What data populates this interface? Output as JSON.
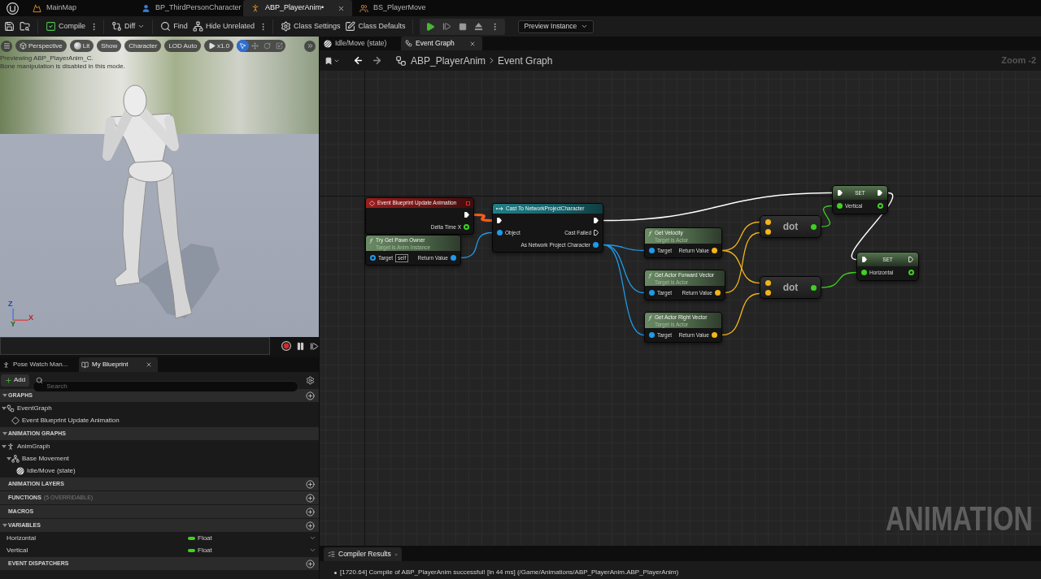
{
  "editor_tabs": [
    {
      "label": "MainMap",
      "kind": "level",
      "selected": false
    },
    {
      "label": "BP_ThirdPersonCharacter",
      "kind": "blueprint",
      "selected": false
    },
    {
      "label": "ABP_PlayerAnim•",
      "kind": "anim_blueprint",
      "selected": true
    },
    {
      "label": "BS_PlayerMove",
      "kind": "blend_space",
      "selected": false
    }
  ],
  "toolbar": {
    "items": [
      {
        "kind": "save",
        "more": false,
        "dropdown": false
      },
      {
        "kind": "browse",
        "more": false,
        "dropdown": false
      },
      {
        "kind": "compile",
        "label": "Compile",
        "more": true,
        "dropdown": false
      },
      {
        "kind": "diff",
        "label": "Diff",
        "more": false,
        "dropdown": true
      },
      {
        "kind": "find",
        "label": "Find",
        "more": false,
        "dropdown": false
      },
      {
        "kind": "hide_unrelated",
        "label": "Hide Unrelated",
        "more": true,
        "dropdown": false
      },
      {
        "kind": "class_settings",
        "label": "Class Settings",
        "more": false,
        "dropdown": false
      },
      {
        "kind": "class_defaults",
        "label": "Class Defaults",
        "more": false,
        "dropdown": false
      }
    ],
    "play_controls": [
      {
        "kind": "play"
      },
      {
        "kind": "advance"
      },
      {
        "kind": "stop"
      },
      {
        "kind": "eject"
      }
    ],
    "debug_dropdown": {
      "label": "Preview Instance"
    }
  },
  "viewport": {
    "toolbar": [
      {
        "kind": "menu"
      },
      {
        "kind": "perspective",
        "label": "Perspective"
      },
      {
        "kind": "lit",
        "label": "Lit"
      },
      {
        "kind": "option",
        "label": "Show"
      },
      {
        "kind": "option",
        "label": "Character"
      },
      {
        "kind": "option",
        "label": "LOD Auto"
      },
      {
        "kind": "speed",
        "label": "x1.0"
      }
    ],
    "transform_tools": [
      {
        "kind": "select",
        "selected": true
      },
      {
        "kind": "move",
        "selected": false
      },
      {
        "kind": "rotate",
        "selected": false
      },
      {
        "kind": "scale",
        "selected": false
      }
    ],
    "messages": [
      "Previewing ABP_PlayerAnim_C.",
      "Bone manipulation is disabled in this mode."
    ],
    "axis_labels": [
      "Z",
      "X",
      "Y"
    ],
    "playback": [
      {
        "kind": "record"
      },
      {
        "kind": "pause"
      },
      {
        "kind": "step"
      }
    ]
  },
  "my_blueprint": {
    "tabs": [
      {
        "label": "Pose Watch Man...",
        "kind": "pose_watch",
        "selected": false
      },
      {
        "label": "My Blueprint",
        "kind": "blueprint",
        "selected": true
      }
    ],
    "add_button": "Add",
    "search": {
      "placeholder": "Search"
    },
    "sections": [
      {
        "title": "GRAPHS",
        "expanded": true,
        "addable": true,
        "items": [
          {
            "label": "EventGraph",
            "kind": "graph",
            "expanded": true,
            "children": [
              {
                "label": "Event Blueprint Update Animation",
                "kind": "event",
                "expanded": false
              }
            ]
          }
        ]
      },
      {
        "title": "ANIMATION GRAPHS",
        "expanded": true,
        "addable": false,
        "items": [
          {
            "label": "AnimGraph",
            "kind": "anim_graph",
            "expanded": true,
            "children": [
              {
                "label": "Base Movement",
                "kind": "state_machine",
                "expanded": true,
                "children": [
                  {
                    "label": "Idle/Move (state)",
                    "kind": "state",
                    "expanded": false
                  }
                ]
              }
            ]
          }
        ]
      },
      {
        "title": "ANIMATION LAYERS",
        "expanded": false,
        "addable": true
      },
      {
        "title": "FUNCTIONS",
        "note": "(5 OVERRIDABLE)",
        "expanded": false,
        "addable": true
      },
      {
        "title": "MACROS",
        "expanded": false,
        "addable": true
      },
      {
        "title": "VARIABLES",
        "expanded": true,
        "addable": true,
        "variables": [
          {
            "name": "Horizontal",
            "type": "Float",
            "color": "#3fd11f"
          },
          {
            "name": "Vertical",
            "type": "Float",
            "color": "#3fd11f"
          }
        ]
      },
      {
        "title": "EVENT DISPATCHERS",
        "expanded": false,
        "addable": true
      }
    ]
  },
  "graph": {
    "tabs": [
      {
        "label": "Idle/Move (state)",
        "kind": "state",
        "selected": false
      },
      {
        "label": "Event Graph",
        "kind": "graph",
        "selected": true
      }
    ],
    "breadcrumb": [
      "ABP_PlayerAnim",
      "Event Graph"
    ],
    "zoom": "Zoom -2",
    "graph_type_label": "ANIMATION",
    "nodes": [
      {
        "kind": "event",
        "title": "Event Blueprint Update Animation",
        "outputs": [
          {
            "kind": "exec",
            "connected": true
          },
          {
            "kind": "data",
            "label": "Delta Time X",
            "color": "#3fd11f",
            "connected": false
          }
        ]
      },
      {
        "kind": "function",
        "title": "Try Get Pawn Owner",
        "subtitle": "Target is Anim Instance",
        "inputs": [
          {
            "kind": "data",
            "label": "Target",
            "color": "#1e9bea",
            "connected": false,
            "default": "self"
          }
        ],
        "outputs": [
          {
            "kind": "data",
            "label": "Return Value",
            "color": "#1e9bea",
            "connected": true
          }
        ]
      },
      {
        "kind": "cast",
        "title": "Cast To NetworkProjectCharacter",
        "inputs": [
          {
            "kind": "exec",
            "connected": true
          },
          {
            "kind": "data",
            "label": "Object",
            "color": "#1e9bea",
            "connected": true
          }
        ],
        "outputs": [
          {
            "kind": "exec",
            "connected": true
          },
          {
            "kind": "exec",
            "label": "Cast Failed",
            "connected": false
          },
          {
            "kind": "data",
            "label": "As Network Project Character",
            "color": "#1e9bea",
            "connected": true
          }
        ]
      },
      {
        "kind": "function",
        "title": "Get Velocity",
        "subtitle": "Target is Actor",
        "inputs": [
          {
            "kind": "data",
            "label": "Target",
            "color": "#1e9bea",
            "connected": true
          }
        ],
        "outputs": [
          {
            "kind": "data",
            "label": "Return Value",
            "color": "#f4b41a",
            "connected": true
          }
        ]
      },
      {
        "kind": "function",
        "title": "Get Actor Forward Vector",
        "subtitle": "Target is Actor",
        "inputs": [
          {
            "kind": "data",
            "label": "Target",
            "color": "#1e9bea",
            "connected": true
          }
        ],
        "outputs": [
          {
            "kind": "data",
            "label": "Return Value",
            "color": "#f4b41a",
            "connected": true
          }
        ]
      },
      {
        "kind": "function",
        "title": "Get Actor Right Vector",
        "subtitle": "Target is Actor",
        "inputs": [
          {
            "kind": "data",
            "label": "Target",
            "color": "#1e9bea",
            "connected": true
          }
        ],
        "outputs": [
          {
            "kind": "data",
            "label": "Return Value",
            "color": "#f4b41a",
            "connected": true
          }
        ]
      },
      {
        "kind": "operator",
        "title": "dot",
        "inputs": [
          {
            "kind": "data",
            "color": "#f4b41a",
            "connected": true
          },
          {
            "kind": "data",
            "color": "#f4b41a",
            "connected": true
          }
        ],
        "outputs": [
          {
            "kind": "data",
            "color": "#3fd11f",
            "connected": true
          }
        ]
      },
      {
        "kind": "operator",
        "title": "dot",
        "inputs": [
          {
            "kind": "data",
            "color": "#f4b41a",
            "connected": true
          },
          {
            "kind": "data",
            "color": "#f4b41a",
            "connected": true
          }
        ],
        "outputs": [
          {
            "kind": "data",
            "color": "#3fd11f",
            "connected": true
          }
        ]
      },
      {
        "kind": "set",
        "title": "SET",
        "inputs": [
          {
            "kind": "exec",
            "connected": true
          },
          {
            "kind": "data",
            "label": "Vertical",
            "color": "#3fd11f",
            "connected": true
          }
        ],
        "outputs": [
          {
            "kind": "exec",
            "connected": true
          },
          {
            "kind": "data",
            "color": "#3fd11f",
            "connected": false
          }
        ]
      },
      {
        "kind": "set",
        "title": "SET",
        "inputs": [
          {
            "kind": "exec",
            "connected": true
          },
          {
            "kind": "data",
            "label": "Horizontal",
            "color": "#3fd11f",
            "connected": true
          }
        ],
        "outputs": [
          {
            "kind": "exec",
            "connected": false
          },
          {
            "kind": "data",
            "color": "#3fd11f",
            "connected": false
          }
        ]
      }
    ]
  },
  "compiler_results": {
    "tab": {
      "label": "Compiler Results"
    },
    "messages": [
      "[1720.64] Compile of ABP_PlayerAnim successful! [in 44 ms] (/Game/Animations/ABP_PlayerAnim.ABP_PlayerAnim)"
    ]
  }
}
